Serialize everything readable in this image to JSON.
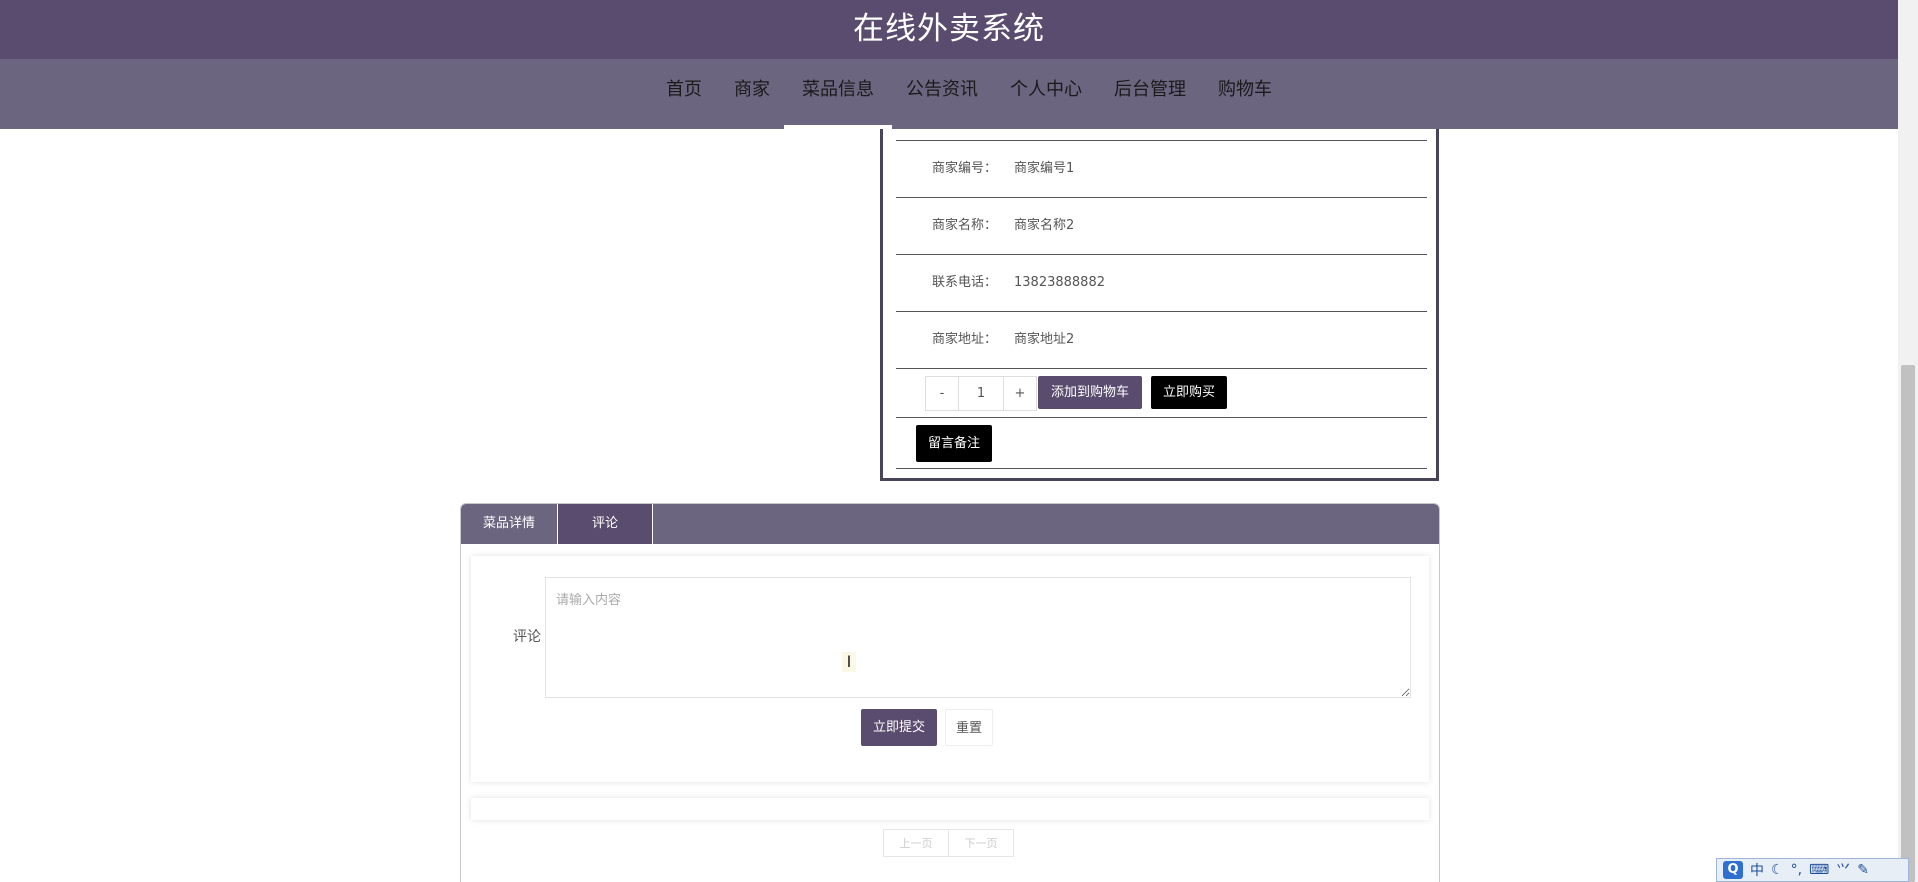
{
  "header": {
    "title": "在线外卖系统"
  },
  "nav": {
    "items": [
      {
        "label": "首页"
      },
      {
        "label": "商家"
      },
      {
        "label": "菜品信息",
        "active": true
      },
      {
        "label": "公告资讯"
      },
      {
        "label": "个人中心"
      },
      {
        "label": "后台管理"
      },
      {
        "label": "购物车"
      }
    ]
  },
  "info": {
    "rows": [
      {
        "label": "商家编号：",
        "value": "商家编号1"
      },
      {
        "label": "商家名称：",
        "value": "商家名称2"
      },
      {
        "label": "联系电话：",
        "value": "13823888882"
      },
      {
        "label": "商家地址：",
        "value": "商家地址2"
      }
    ],
    "quantity": {
      "minus": "-",
      "value": "1",
      "plus": "+"
    },
    "add_to_cart": "添加到购物车",
    "buy_now": "立即购买",
    "leave_note": "留言备注"
  },
  "tabs": {
    "items": [
      {
        "label": "菜品详情"
      },
      {
        "label": "评论",
        "active": true
      }
    ]
  },
  "comment": {
    "label": "评论",
    "placeholder": "请输入内容",
    "submit": "立即提交",
    "reset": "重置"
  },
  "pager": {
    "prev": "上一页",
    "next": "下一页"
  },
  "ime": {
    "logo": "Q",
    "lang": "中",
    "moon": "☾",
    "punct": "°,",
    "keyboard": "⌨",
    "simp": "⺍",
    "tool": "✎"
  },
  "colors": {
    "header_bg": "#5a4c6e",
    "nav_bg": "#6c6580",
    "accent": "#5a4c6e",
    "black_button": "#000000"
  }
}
